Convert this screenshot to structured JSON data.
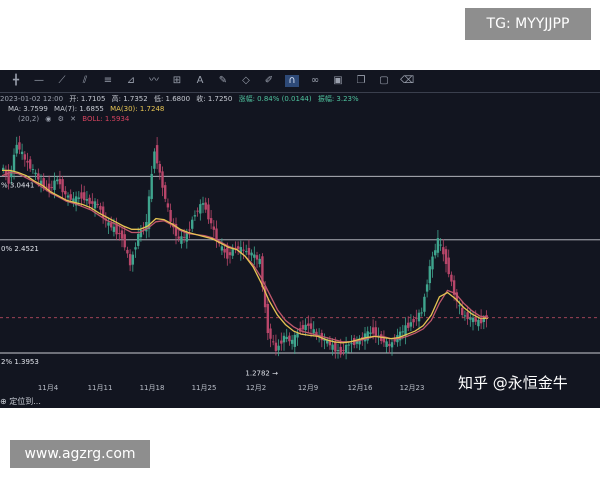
{
  "badges": {
    "telegram": "TG: MYYJJPP",
    "site": "www.agzrg.com"
  },
  "toolbar": {
    "icons": [
      "cursor-icon",
      "horizontal-line-icon",
      "trend-line-icon",
      "parallel-channel-icon",
      "fibonacci-icon",
      "measure-icon",
      "wave-icon",
      "add-indicator-icon",
      "text-icon",
      "brush-icon",
      "eraser-icon",
      "pen-icon",
      "magnet-icon",
      "link-icon",
      "lock-icon",
      "copy-icon",
      "screenshot-icon",
      "trash-icon"
    ],
    "active_index": 12
  },
  "ohlc_bar": {
    "date": "2023-01-02 12:00",
    "open": "开: 1.7105",
    "high": "高: 1.7352",
    "low": "低: 1.6800",
    "close": "收: 1.7250",
    "change": "涨幅: 0.84% (0.0144)",
    "amplitude": "振幅: 3.23%"
  },
  "ma_bar": {
    "ma": "MA: 3.7599",
    "ma7": "MA(7): 1.6855",
    "ma30": "MA(30): 1.7248"
  },
  "boll_bar": {
    "label": "(20,2)",
    "boll": "BOLL: 1.5934"
  },
  "watermark": "知乎 @永恒金牛",
  "locate_label": "定位到...",
  "colors": {
    "background": "#121520",
    "up_candle": "#3fa58e",
    "down_candle": "#b8466a",
    "ma_line": "#e6c453",
    "boll_line": "#c0586d",
    "level_line": "#c9ccd2",
    "current_price_line": "#b24a5e"
  },
  "chart_data": {
    "type": "candlestick",
    "x_tick_labels": [
      "11月4",
      "11月11",
      "11月18",
      "11月25",
      "12月2",
      "12月9",
      "12月16",
      "12月23"
    ],
    "horizontal_levels": [
      {
        "label": "% 3.0441",
        "value": 3.0441
      },
      {
        "label": "0% 2.4521",
        "value": 2.4521
      },
      {
        "label": "2% 1.3953",
        "value": 1.3953
      }
    ],
    "low_marker": {
      "label": "1.2782 →",
      "value": 1.2782
    },
    "current_price": 1.725,
    "ylim": [
      1.05,
      3.85
    ],
    "close_path": [
      3.15,
      3.0,
      3.35,
      3.2,
      3.1,
      2.98,
      2.92,
      3.02,
      2.87,
      2.82,
      2.86,
      2.8,
      2.78,
      2.62,
      2.55,
      2.48,
      2.22,
      2.5,
      2.6,
      3.3,
      2.95,
      2.62,
      2.45,
      2.5,
      2.7,
      2.8,
      2.6,
      2.4,
      2.3,
      2.38,
      2.35,
      2.32,
      2.25,
      1.6,
      1.42,
      1.55,
      1.5,
      1.62,
      1.66,
      1.56,
      1.52,
      1.45,
      1.4,
      1.48,
      1.5,
      1.56,
      1.6,
      1.52,
      1.46,
      1.55,
      1.63,
      1.7,
      1.78,
      2.2,
      2.45,
      2.25,
      1.95,
      1.75,
      1.72,
      1.68,
      1.73
    ],
    "ma_path": [
      3.1,
      3.1,
      3.08,
      3.05,
      3.0,
      2.96,
      2.9,
      2.86,
      2.82,
      2.8,
      2.78,
      2.75,
      2.7,
      2.66,
      2.62,
      2.58,
      2.55,
      2.55,
      2.58,
      2.65,
      2.64,
      2.6,
      2.55,
      2.52,
      2.5,
      2.48,
      2.46,
      2.42,
      2.38,
      2.36,
      2.3,
      2.2,
      2.05,
      1.88,
      1.75,
      1.66,
      1.6,
      1.57,
      1.56,
      1.55,
      1.52,
      1.5,
      1.49,
      1.5,
      1.52,
      1.54,
      1.55,
      1.54,
      1.53,
      1.54,
      1.57,
      1.6,
      1.65,
      1.75,
      1.92,
      1.96,
      1.9,
      1.82,
      1.76,
      1.72,
      1.72
    ],
    "boll_path": [
      3.05,
      3.08,
      3.07,
      3.03,
      2.99,
      2.94,
      2.89,
      2.85,
      2.81,
      2.79,
      2.76,
      2.73,
      2.68,
      2.63,
      2.6,
      2.56,
      2.52,
      2.52,
      2.56,
      2.62,
      2.63,
      2.59,
      2.54,
      2.51,
      2.5,
      2.49,
      2.47,
      2.43,
      2.39,
      2.36,
      2.3,
      2.22,
      2.1,
      1.95,
      1.8,
      1.7,
      1.64,
      1.6,
      1.58,
      1.56,
      1.54,
      1.52,
      1.5,
      1.5,
      1.51,
      1.53,
      1.55,
      1.55,
      1.53,
      1.53,
      1.55,
      1.58,
      1.62,
      1.7,
      1.86,
      1.98,
      1.95,
      1.86,
      1.79,
      1.74,
      1.73
    ]
  }
}
